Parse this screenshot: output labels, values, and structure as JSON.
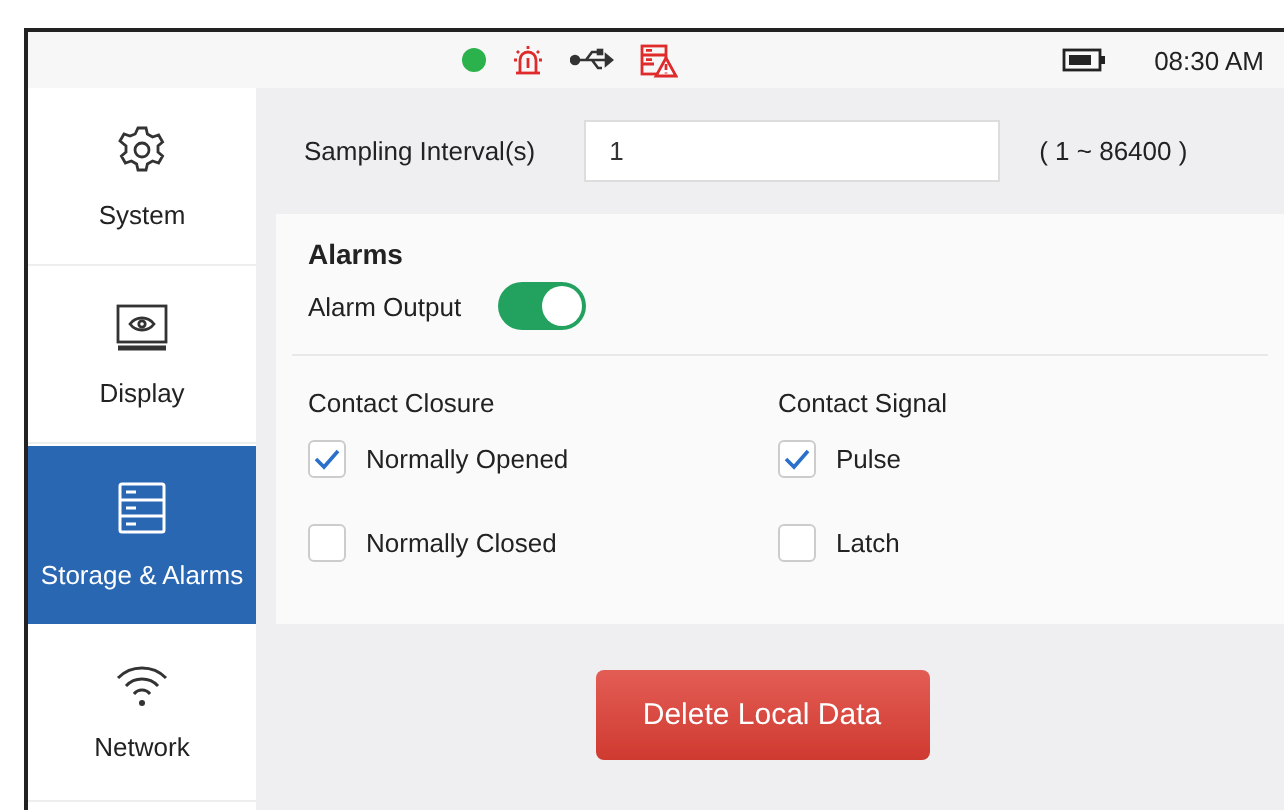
{
  "status_bar": {
    "icons": [
      {
        "kind": "dot"
      },
      {
        "kind": "alarm"
      },
      {
        "kind": "usb"
      },
      {
        "kind": "storage-alert"
      }
    ],
    "time": "08:30 AM"
  },
  "sidebar": {
    "items": [
      {
        "label": "System",
        "kind": "gear",
        "selected": false
      },
      {
        "label": "Display",
        "kind": "display",
        "selected": false
      },
      {
        "label": "Storage & Alarms",
        "kind": "storage",
        "selected": true
      },
      {
        "label": "Network",
        "kind": "wifi",
        "selected": false
      }
    ]
  },
  "sampling": {
    "label": "Sampling Interval(s)",
    "value": "1",
    "range": "( 1 ~ 86400 )"
  },
  "alarms": {
    "title": "Alarms",
    "output": {
      "label": "Alarm Output",
      "on": true
    },
    "groups": [
      {
        "title": "Contact Closure",
        "options": [
          {
            "label": "Normally Opened",
            "checked": true
          },
          {
            "label": "Normally Closed",
            "checked": false
          }
        ]
      },
      {
        "title": "Contact Signal",
        "options": [
          {
            "label": "Pulse",
            "checked": true
          },
          {
            "label": "Latch",
            "checked": false
          }
        ]
      }
    ]
  },
  "button": "Delete Local Data"
}
